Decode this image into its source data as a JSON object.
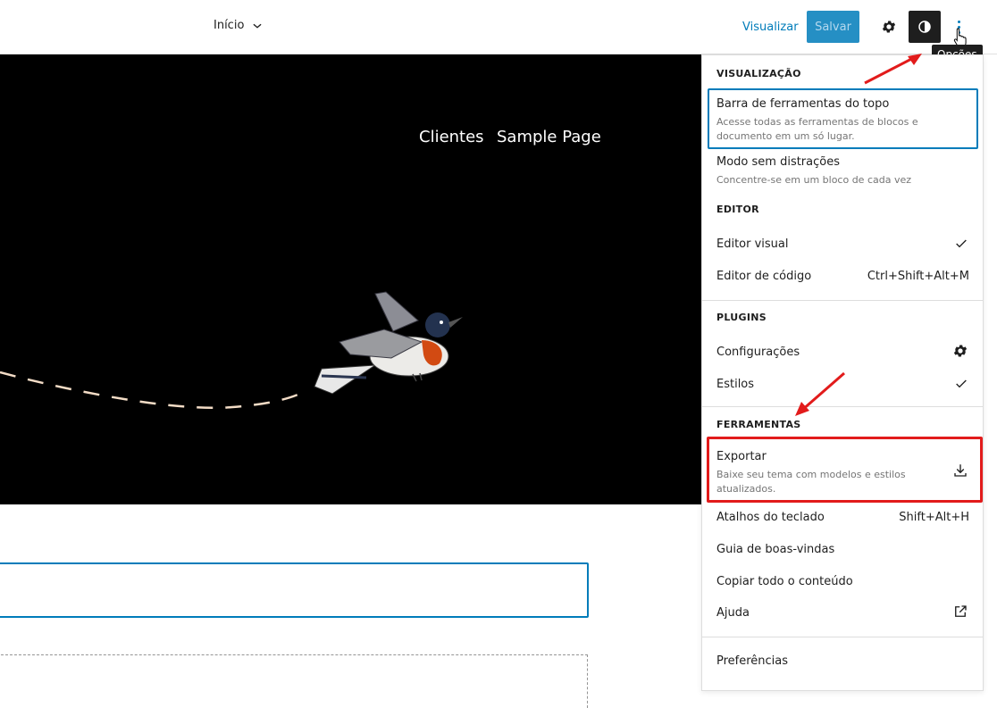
{
  "header": {
    "doc_title": "Início",
    "preview_label": "Visualizar",
    "save_label": "Salvar",
    "tooltip": "Opções"
  },
  "canvas": {
    "nav": [
      "Clientes",
      "Sample Page"
    ]
  },
  "menu": {
    "section_view": "VISUALIZAÇÃO",
    "top_toolbar_label": "Barra de ferramentas do topo",
    "top_toolbar_desc_1": "Acesse todas as ferramentas de blocos e",
    "top_toolbar_desc_2": "documento em um só lugar.",
    "distraction_label": "Modo sem distrações",
    "distraction_desc": "Concentre-se em um bloco de cada vez",
    "section_editor": "EDITOR",
    "visual_editor": "Editor visual",
    "code_editor": "Editor de código",
    "code_editor_shortcut": "Ctrl+Shift+Alt+M",
    "section_plugins": "PLUGINS",
    "settings": "Configurações",
    "styles": "Estilos",
    "section_tools": "FERRAMENTAS",
    "export_label": "Exportar",
    "export_desc_1": "Baixe seu tema com modelos e estilos",
    "export_desc_2": "atualizados.",
    "shortcuts": "Atalhos do teclado",
    "shortcuts_key": "Shift+Alt+H",
    "welcome": "Guia de boas-vindas",
    "copy_all": "Copiar todo o conteúdo",
    "help": "Ajuda",
    "preferences": "Preferências"
  },
  "colors": {
    "accent": "#007cba",
    "annotation": "#e21b1b"
  }
}
